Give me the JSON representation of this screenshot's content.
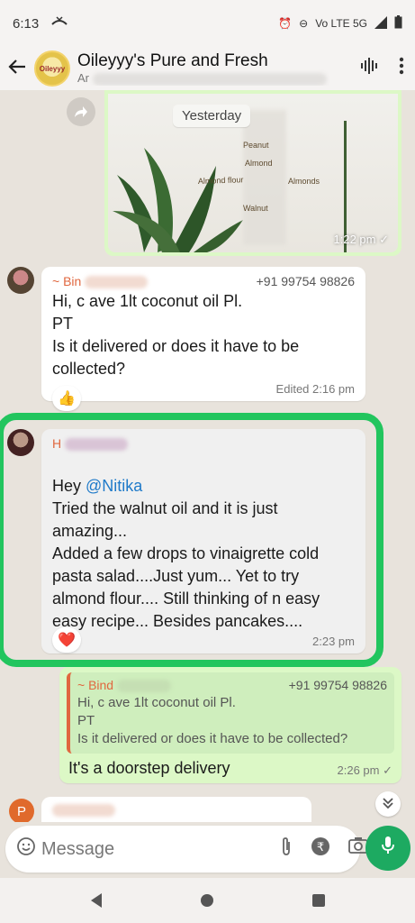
{
  "status_bar": {
    "time": "6:13",
    "indicators": "Vo LTE 5G"
  },
  "header": {
    "back_icon": "arrow-left-icon",
    "avatar_text": "Oileyyy",
    "title": "Oileyyy's Pure and Fresh",
    "subtitle_prefix": "Ar",
    "actions": [
      "voice-chat-icon",
      "more-vert-icon"
    ]
  },
  "messages": {
    "image_message": {
      "date_label": "Yesterday",
      "time": "1:22 pm ✓"
    },
    "msg1": {
      "sender": "~ Bin",
      "phone": "+91 99754 98826",
      "text": "Hi, c           ave  1lt coconut oil Pl.\nPT\nIs it delivered or does it have to be collected?",
      "meta": "Edited 2:16 pm",
      "reaction": "👍"
    },
    "msg2": {
      "sender": "H",
      "greeting": "Hey ",
      "mention": "@Nitika",
      "text": "Tried the walnut oil and it is just amazing...\nAdded a few drops to vinaigrette cold pasta salad....Just yum... Yet to try almond flour.... Still thinking of n easy easy recipe... Besides pancakes....",
      "time": "2:23 pm",
      "reaction": "❤️"
    },
    "msg3": {
      "quote_sender": "~ Bind",
      "quote_phone": "+91 99754 98826",
      "quote_text": "Hi, c            ave  1lt coconut oil Pl.\nPT\nIs it delivered or does it have to be collected?",
      "text": "It's a doorstep delivery",
      "time": "2:26 pm ✓"
    },
    "next_avatar_initial": "P"
  },
  "composer": {
    "placeholder": "Message"
  },
  "colors": {
    "accent_green": "#1daa61",
    "outgoing_bubble": "#dcf8c6",
    "highlight": "#22c55e",
    "sender_orange": "#e0673f"
  }
}
